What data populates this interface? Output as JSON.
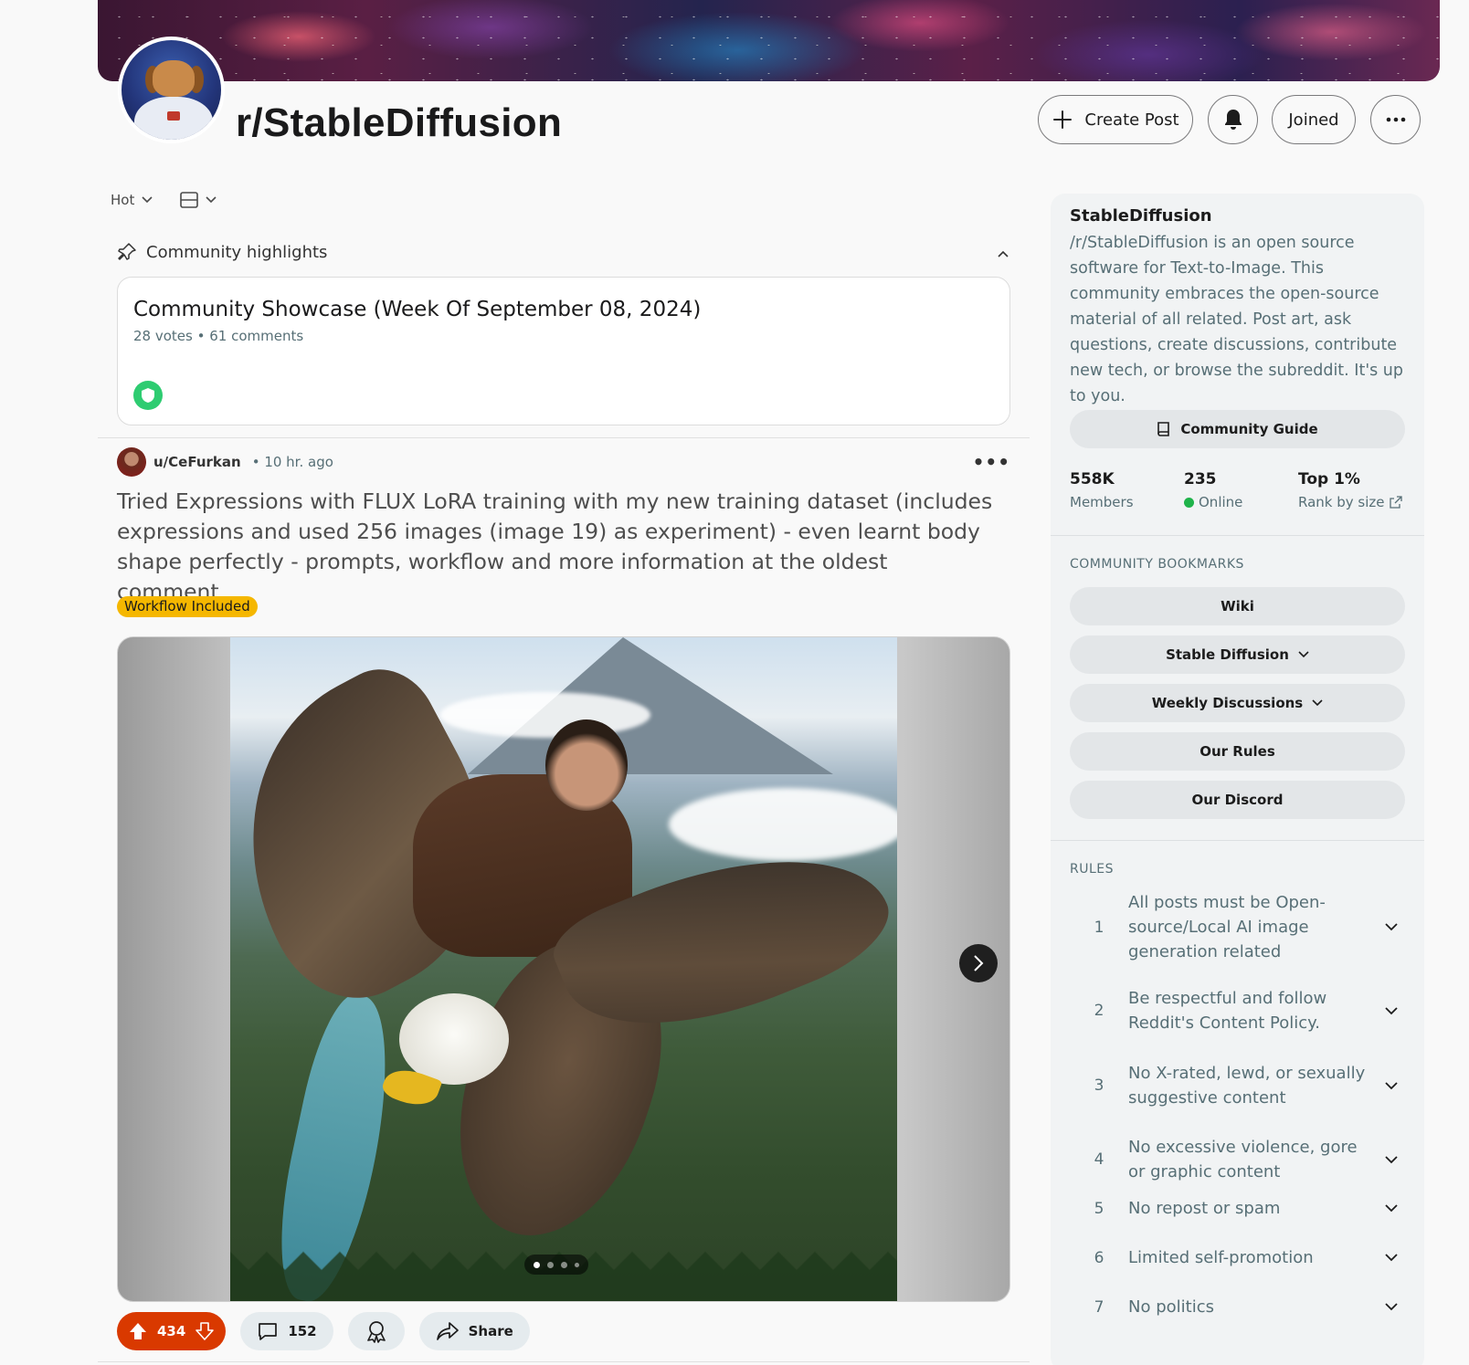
{
  "subreddit": {
    "name": "r/StableDiffusion",
    "create_post_label": "Create Post",
    "joined_label": "Joined"
  },
  "feed": {
    "sort_label": "Hot",
    "highlights_label": "Community highlights",
    "showcase": {
      "title": "Community Showcase (Week Of September 08, 2024)",
      "meta": "28 votes • 61 comments"
    }
  },
  "post": {
    "author": "u/CeFurkan",
    "time": "• 10 hr. ago",
    "title": "Tried Expressions with FLUX LoRA training with my new training dataset (includes expressions and used 256 images (image 19) as experiment) - even learnt body shape perfectly - prompts, workflow and more information at the oldest comment",
    "flair": "Workflow Included",
    "votes": "434",
    "comments": "152",
    "share_label": "Share"
  },
  "sidebar": {
    "name": "StableDiffusion",
    "description": "/r/StableDiffusion is an open source software for Text-to-Image. This community embraces the open-source material of all related. Post art, ask questions, create discussions, contribute new tech, or browse the subreddit. It's up to you.",
    "guide_label": "Community Guide",
    "stats": {
      "members_value": "558K",
      "members_label": "Members",
      "online_value": "235",
      "online_label": "Online",
      "rank_value": "Top 1%",
      "rank_label": "Rank by size"
    },
    "bookmarks_title": "COMMUNITY BOOKMARKS",
    "bookmarks": [
      "Wiki",
      "Stable Diffusion",
      "Weekly Discussions",
      "Our Rules",
      "Our Discord"
    ],
    "rules_title": "RULES",
    "rules": [
      {
        "num": "1",
        "text": "All posts must be Open-source/Local AI image generation related"
      },
      {
        "num": "2",
        "text": "Be respectful and follow Reddit's Content Policy."
      },
      {
        "num": "3",
        "text": "No X-rated, lewd, or sexually suggestive content"
      },
      {
        "num": "4",
        "text": "No excessive violence, gore or graphic content"
      },
      {
        "num": "5",
        "text": "No repost or spam"
      },
      {
        "num": "6",
        "text": "Limited self-promotion"
      },
      {
        "num": "7",
        "text": "No politics"
      }
    ]
  },
  "colors": {
    "upvote_active": "#d93900",
    "flair": "#f5b700",
    "online": "#1fb34a"
  }
}
